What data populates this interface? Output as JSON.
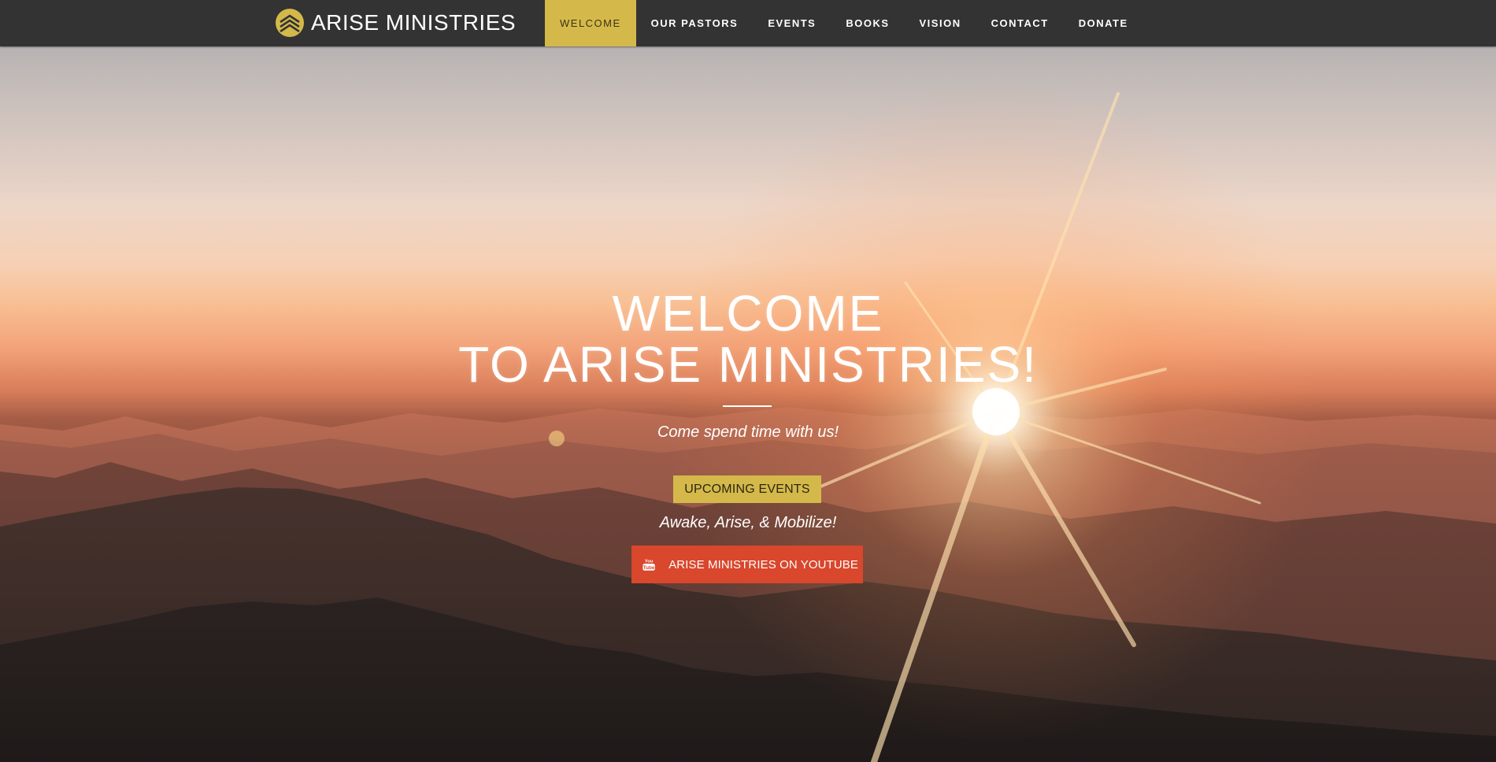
{
  "brand": {
    "name": "ARISE MINISTRIES",
    "logo_icon": "chevron-stack-logo-icon",
    "color": "#d4b94a"
  },
  "nav": {
    "items": [
      {
        "label": "WELCOME",
        "active": true
      },
      {
        "label": "OUR PASTORS",
        "active": false
      },
      {
        "label": "EVENTS",
        "active": false
      },
      {
        "label": "BOOKS",
        "active": false
      },
      {
        "label": "VISION",
        "active": false
      },
      {
        "label": "CONTACT",
        "active": false
      },
      {
        "label": "DONATE",
        "active": false
      }
    ],
    "active_color": "#d4b94a",
    "bar_color": "#333333"
  },
  "hero": {
    "title_line1": "WELCOME",
    "title_line2": "TO ARISE MINISTRIES!",
    "tagline": "Come spend time with us!",
    "events_button": "UPCOMING EVENTS",
    "motto": "Awake, Arise, & Mobilize!",
    "youtube_button": "ARISE MINISTRIES ON YOUTUBE",
    "youtube_icon": "youtube-logo-icon",
    "youtube_icon_text_top": "You",
    "youtube_icon_text_bottom": "Tube",
    "youtube_color": "#d9472c",
    "background": "mountain-sunset-image"
  }
}
